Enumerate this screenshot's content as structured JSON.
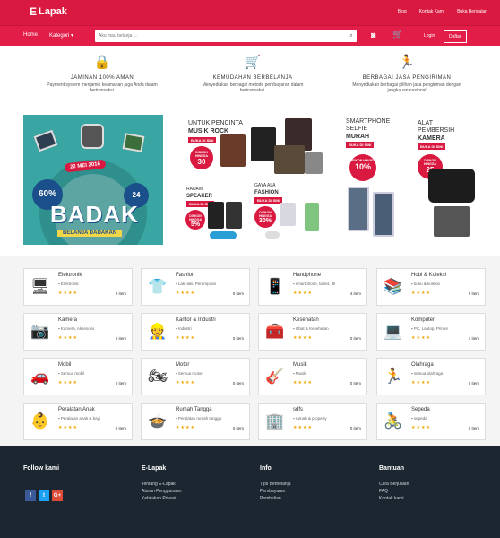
{
  "header": {
    "logo": "Lapak",
    "logo_prefix": "E",
    "links": [
      "Blog",
      "Kontak Kami",
      "Buka Berjualan"
    ]
  },
  "nav": {
    "home": "Home",
    "category": "Kategori",
    "search_placeholder": "Aku mau belanja ...",
    "login": "Login",
    "register": "Daftar"
  },
  "features": [
    {
      "title": "JAMINAN 100% AMAN",
      "desc": "Payment system menjamin keamanan juga Anda dalam bertransaksi.",
      "icon": "lock-icon"
    },
    {
      "title": "KEMUDAHAN BERBELANJA",
      "desc": "Menyediakan berbagai metode pembayaran dalam bertransaksi.",
      "icon": "cart-icon"
    },
    {
      "title": "BERBAGAI JASA PENGIRIMAN",
      "desc": "Menyediakan berbagai pilihan jasa pengiriman dengan jangkauan nasional",
      "icon": "delivery-icon"
    }
  ],
  "banner": {
    "date": "22 MEI 2016",
    "discount_prefix": "Disc Up To",
    "discount": "60%",
    "hours": "24",
    "hours_unit": "jam",
    "brand": "BADAK",
    "tagline": "BELANJA DADAKAN"
  },
  "promos": [
    {
      "line1": "UNTUK PENCINTA",
      "line2": "MUSIK ROCK",
      "cta": "BUKA DI SINI",
      "disc_label": "DISKON HINGGA",
      "disc": "30",
      "disc_unit": "PERSEN"
    },
    {
      "line1": "RADAM",
      "line2": "SPEAKER",
      "cta": "BUKA DI SINI",
      "disc_label": "DISKON HINGGA",
      "disc": "5%"
    },
    {
      "line1": "GAYA ALA",
      "line2": "FASHION",
      "cta": "BUKA DI SINI",
      "disc_label": "DISKON HINGGA",
      "disc": "30%"
    },
    {
      "line1": "SMARTPHONE SELFIE",
      "line2": "MURAH",
      "cta": "BUKA DI SINI",
      "disc_label": "DISKON HINGGA",
      "disc": "10%"
    },
    {
      "line1": "ALAT PEMBERSIH",
      "line2": "KAMERA",
      "cta": "BUKA DI SINI",
      "disc_label": "DISKON HINGGA",
      "disc": "25",
      "disc_unit": "PERSEN"
    }
  ],
  "categories": [
    {
      "name": "Elektronik",
      "sub": "Elektronik",
      "count": "0 item",
      "icon": "tv-icon",
      "glyph": "🖥"
    },
    {
      "name": "Fashion",
      "sub": "Laki-laki, Perempuan",
      "count": "0 item",
      "icon": "shirt-icon",
      "glyph": "👕"
    },
    {
      "name": "Handphone",
      "sub": "smartphone, tablet, dll",
      "count": "4 item",
      "icon": "phone-icon",
      "glyph": "📱"
    },
    {
      "name": "Hobi & Koleksi",
      "sub": "buku & koleksi",
      "count": "0 item",
      "icon": "books-icon",
      "glyph": "📚"
    },
    {
      "name": "Kamera",
      "sub": "Kamera, Aksesoris",
      "count": "0 item",
      "icon": "camera-icon",
      "glyph": "📷"
    },
    {
      "name": "Kantor & Industri",
      "sub": "Industri",
      "count": "0 item",
      "icon": "worker-icon",
      "glyph": "👷"
    },
    {
      "name": "Kesehatan",
      "sub": "Obat & Kesehatan",
      "count": "0 item",
      "icon": "medkit-icon",
      "glyph": "🧰"
    },
    {
      "name": "Komputer",
      "sub": "PC, Laptop, Printer",
      "count": "1 item",
      "icon": "laptop-icon",
      "glyph": "💻"
    },
    {
      "name": "Mobil",
      "sub": "Semua mobil",
      "count": "0 item",
      "icon": "car-icon",
      "glyph": "🚗"
    },
    {
      "name": "Motor",
      "sub": "Semua motor",
      "count": "0 item",
      "icon": "motorcycle-icon",
      "glyph": "🏍"
    },
    {
      "name": "Musik",
      "sub": "Musik",
      "count": "0 item",
      "icon": "guitar-icon",
      "glyph": "🎸"
    },
    {
      "name": "Olahraga",
      "sub": "semua olahraga",
      "count": "0 item",
      "icon": "runner-icon",
      "glyph": "🏃"
    },
    {
      "name": "Peralatan Anak",
      "sub": "Peralatan anak & bayi",
      "count": "0 item",
      "icon": "stroller-icon",
      "glyph": "👶"
    },
    {
      "name": "Rumah Tangga",
      "sub": "Peralatan rumah tangga",
      "count": "0 item",
      "icon": "pot-icon",
      "glyph": "🍲"
    },
    {
      "name": "sdfs",
      "sub": "rumah & property",
      "count": "0 item",
      "icon": "building-icon",
      "glyph": "🏢"
    },
    {
      "name": "Sepeda",
      "sub": "sepeda",
      "count": "0 item",
      "icon": "bicycle-icon",
      "glyph": "🚴"
    }
  ],
  "stars": "★★★★",
  "footer": {
    "follow": "Follow kami",
    "social": [
      "f",
      "t",
      "G+"
    ],
    "cols": [
      {
        "title": "E-Lapak",
        "links": [
          "Tentang E-Lapak",
          "Aturan Penggunaan",
          "Kebijakan Privasi"
        ]
      },
      {
        "title": "Info",
        "links": [
          "Tips Berbelanja",
          "Pembayaran",
          "Pembelian"
        ]
      },
      {
        "title": "Bantuan",
        "links": [
          "Cara Berjualan",
          "FAQ",
          "Kontak kami"
        ]
      }
    ]
  },
  "colors": {
    "brand": "#e11d48",
    "footer": "#1b2631",
    "star": "#f0a500"
  }
}
